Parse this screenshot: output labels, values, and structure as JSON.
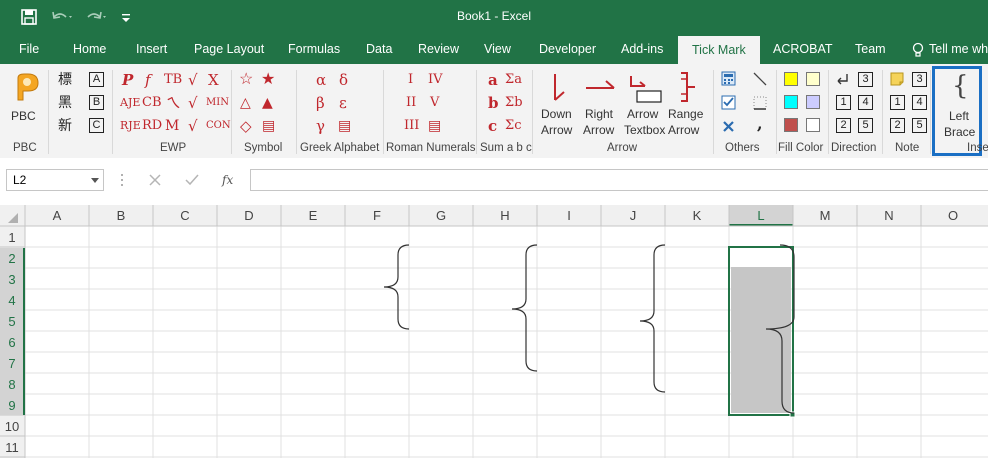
{
  "app": {
    "window_title": "Book1  -  Excel"
  },
  "qat": {
    "save_icon": "save-icon",
    "undo_icon": "undo-icon",
    "redo_icon": "redo-icon",
    "customize_icon": "customize-icon"
  },
  "tabs": [
    "File",
    "Home",
    "Insert",
    "Page Layout",
    "Formulas",
    "Data",
    "Review",
    "View",
    "Developer",
    "Add-ins",
    "Tick Mark",
    "ACROBAT",
    "Team",
    "Tell me wh"
  ],
  "active_tab": "Tick Mark",
  "colors": {
    "excel_green": "#217346",
    "ribbon_bg": "#f3f3f3",
    "symbol_red": "#c0272d",
    "selection": "#217346",
    "highlight_box": "#1a6fc4"
  },
  "ribbon": {
    "pbc": {
      "label": "PBC",
      "group": "PBC"
    },
    "boxes": {
      "chars": [
        "標",
        "黑",
        "新"
      ],
      "letters": [
        "A",
        "B",
        "C"
      ]
    },
    "ewp": {
      "group": "EWP",
      "rows": [
        [
          "P",
          "f",
          "TB",
          "√",
          "X"
        ],
        [
          "AJE",
          "CB",
          "ㄟ",
          "√",
          "MIN"
        ],
        [
          "RJE",
          "RD",
          "M",
          "√",
          "CON"
        ]
      ]
    },
    "symbol": {
      "group": "Symbol",
      "rows": [
        [
          "☆",
          "★"
        ],
        [
          "△",
          "▲"
        ],
        [
          "◇",
          "▤"
        ]
      ]
    },
    "greek": {
      "group": "Greek Alphabet",
      "rows": [
        [
          "α",
          "δ"
        ],
        [
          "β",
          "ε"
        ],
        [
          "γ",
          "▤"
        ]
      ]
    },
    "roman": {
      "group": "Roman Numerals",
      "rows": [
        [
          "I",
          "IV"
        ],
        [
          "II",
          "V"
        ],
        [
          "III",
          "▤"
        ]
      ]
    },
    "sum": {
      "group": "Sum a b c",
      "rows": [
        [
          "a",
          "Σa"
        ],
        [
          "b",
          "Σb"
        ],
        [
          "c",
          "Σc"
        ]
      ]
    },
    "arrow": {
      "group": "Arrow",
      "down": [
        "Down",
        "Arrow"
      ],
      "right": [
        "Right",
        "Arrow"
      ],
      "textbox": [
        "Arrow",
        "Textbox"
      ],
      "range": [
        "Range",
        "Arrow"
      ]
    },
    "others": {
      "group": "Others",
      "comma": ","
    },
    "fill": {
      "group": "Fill Color"
    },
    "direction": {
      "group": "Direction",
      "items": [
        "3",
        "1",
        "4",
        "2",
        "5"
      ]
    },
    "note": {
      "group": "Note",
      "items": [
        "3",
        "1",
        "4",
        "2",
        "5"
      ]
    },
    "insert": {
      "group": "Inse",
      "brace_glyph": "{",
      "label": [
        "Left",
        "Brace"
      ]
    }
  },
  "formula_bar": {
    "name_box": "L2",
    "cancel_icon": "cancel-icon",
    "enter_icon": "enter-icon",
    "fx": "fx",
    "value": ""
  },
  "sheet": {
    "columns": [
      "A",
      "B",
      "C",
      "D",
      "E",
      "F",
      "G",
      "H",
      "I",
      "J",
      "K",
      "L",
      "M",
      "N",
      "O"
    ],
    "rows": [
      "1",
      "2",
      "3",
      "4",
      "5",
      "6",
      "7",
      "8",
      "9",
      "10",
      "11"
    ],
    "selected_column": "L",
    "active_cell": "L2",
    "selected_range": "L2:L9"
  }
}
